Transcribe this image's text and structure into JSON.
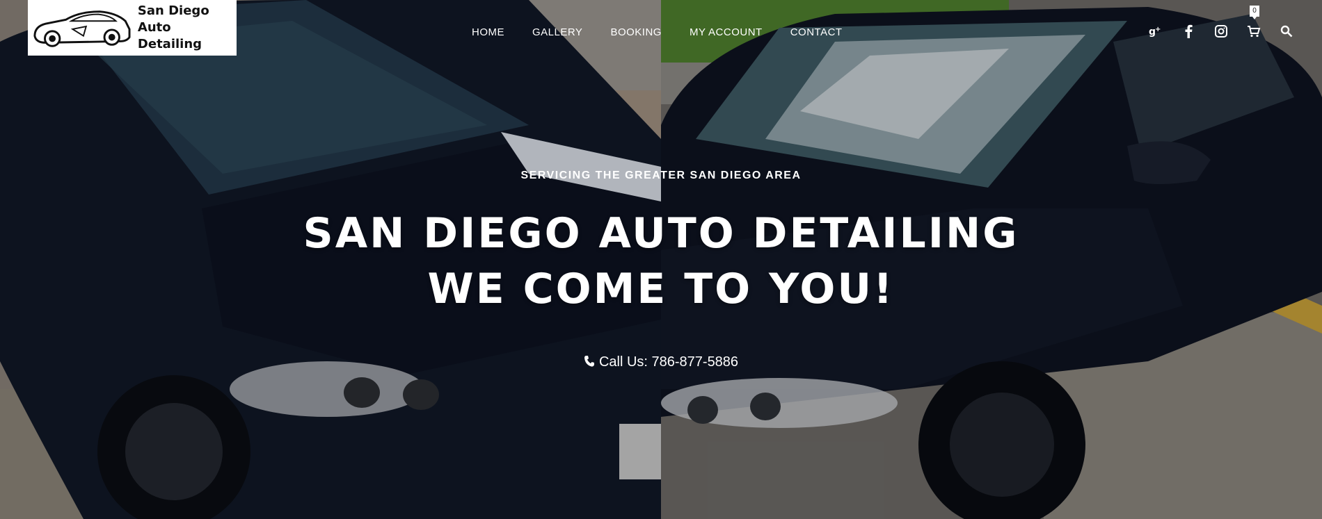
{
  "brand": {
    "name_line1": "San Diego",
    "name_line2": "Auto Detailing"
  },
  "nav": {
    "items": [
      "HOME",
      "GALLERY",
      "BOOKING",
      "MY ACCOUNT",
      "CONTACT"
    ]
  },
  "social": {
    "icons": [
      "google-plus-icon",
      "facebook-icon",
      "instagram-icon",
      "cart-icon",
      "search-icon"
    ],
    "cart_count": "0"
  },
  "hero": {
    "subtitle": "SERVICING THE GREATER SAN DIEGO AREA",
    "title_line1": "SAN DIEGO AUTO DETAILING",
    "title_line2": "WE COME TO YOU!",
    "call_text": "Call Us: 786-877-5886"
  },
  "colors": {
    "text": "#ffffff",
    "car_paint": "#0f1522",
    "logo_bg": "#ffffff"
  }
}
